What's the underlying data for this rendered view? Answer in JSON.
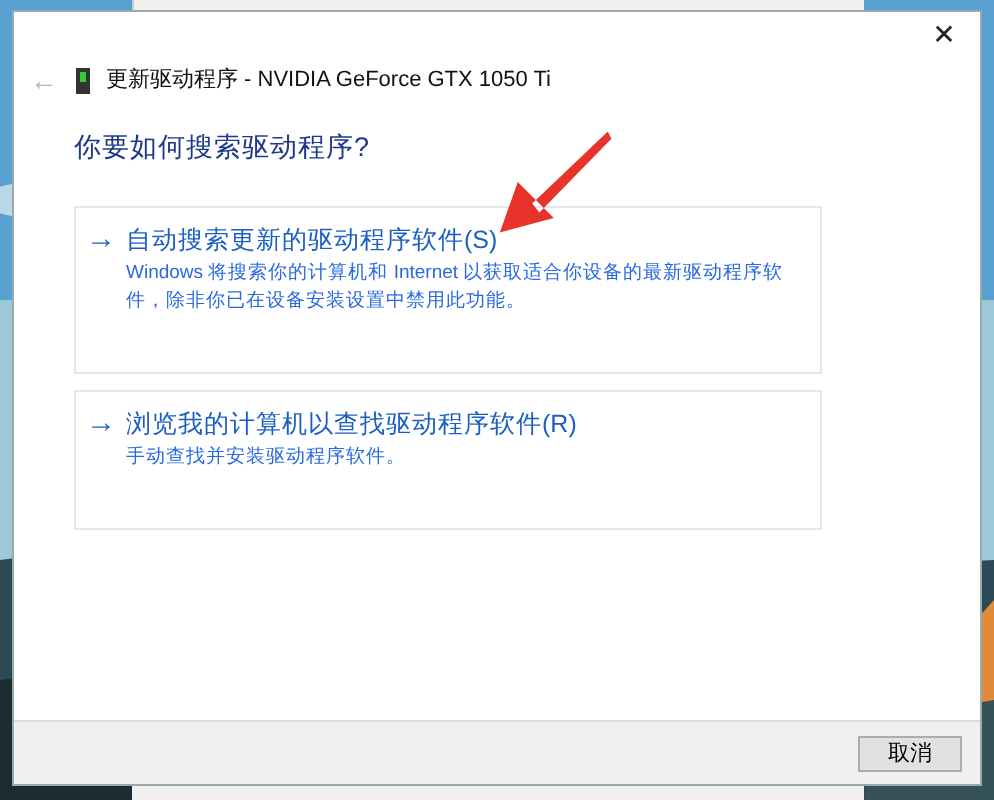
{
  "window": {
    "title": "更新驱动程序 - NVIDIA GeForce GTX 1050 Ti",
    "close": "✕"
  },
  "back_button": {
    "label": "←",
    "disabled": true
  },
  "heading": "你要如何搜索驱动程序?",
  "options": [
    {
      "arrow": "→",
      "title": "自动搜索更新的驱动程序软件(S)",
      "description": "Windows 将搜索你的计算机和 Internet 以获取适合你设备的最新驱动程序软件，除非你已在设备安装设置中禁用此功能。"
    },
    {
      "arrow": "→",
      "title": "浏览我的计算机以查找驱动程序软件(R)",
      "description": "手动查找并安装驱动程序软件。"
    }
  ],
  "buttons": [
    {
      "label": "取消"
    }
  ]
}
